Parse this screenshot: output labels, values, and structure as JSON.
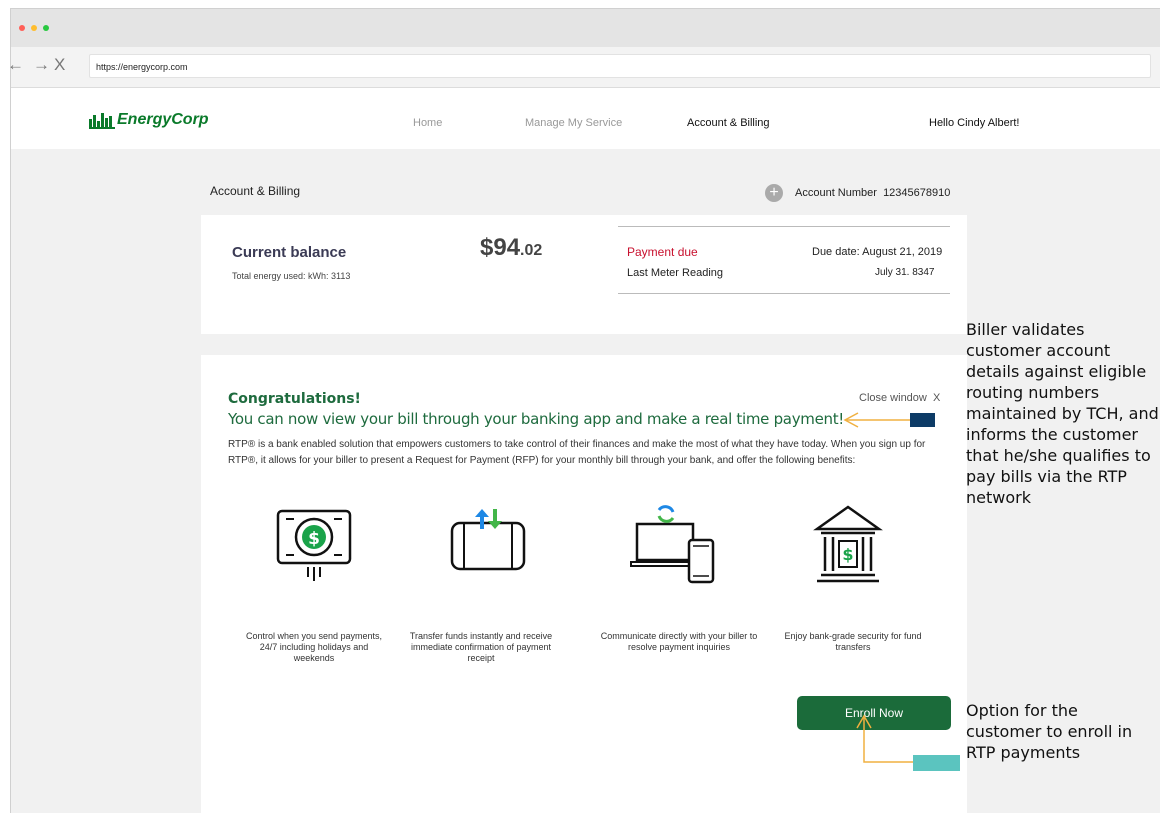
{
  "browser": {
    "url": "https://energycorp.com",
    "nav": {
      "back": "←",
      "forward": "→",
      "close": "X"
    }
  },
  "header": {
    "brand": "EnergyCorp",
    "nav": [
      {
        "label": "Home"
      },
      {
        "label": "Manage My Service"
      },
      {
        "label": "Account & Billing"
      }
    ],
    "greeting": "Hello Cindy Albert!"
  },
  "page": {
    "title": "Account & Billing",
    "account_label": "Account Number",
    "account_number": "12345678910",
    "plus_symbol": "+"
  },
  "balance": {
    "label": "Current balance",
    "energy_used": "Total energy used: kWh: 3113",
    "amount_dollars": "$94",
    "amount_cents": ".02",
    "payment_due_label": "Payment due",
    "due_date": "Due date: August 21, 2019",
    "meter_label": "Last Meter Reading",
    "meter_value": "July 31. 8347"
  },
  "promo": {
    "heading": "Congratulations!",
    "close_label": "Close window",
    "close_x": "X",
    "subheading": "You can now view your bill through your banking app and make a real time payment!",
    "description": "RTP® is a bank enabled solution that empowers customers to take control of their finances and make the most of what they have today. When you sign up for RTP®, it allows for your biller to present a Request for Payment (RFP) for your monthly bill through your bank, and offer the following benefits:",
    "benefits": [
      {
        "icon": "money-bill-icon",
        "text": "Control when you send payments, 24/7 including holidays and weekends"
      },
      {
        "icon": "transfer-icon",
        "text": "Transfer funds instantly and receive immediate confirmation of payment receipt"
      },
      {
        "icon": "devices-icon",
        "text": "Communicate directly with your biller to resolve payment inquiries"
      },
      {
        "icon": "bank-icon",
        "text": "Enjoy bank-grade security for fund transfers"
      }
    ],
    "enroll_label": "Enroll Now"
  },
  "annotations": {
    "validation_note": "Biller validates customer account details against eligible routing numbers maintained by TCH, and informs the customer that he/she qualifies to pay bills via the RTP network",
    "enroll_note": "Option for the customer to enroll in RTP payments"
  },
  "colors": {
    "brand_green": "#0a7a2a",
    "enroll_green": "#1b6b3a",
    "promo_green": "#1e6b3e",
    "payment_due_red": "#c8102e",
    "arrow_orange": "#f0b040",
    "marker_navy": "#0d3b66",
    "marker_teal": "#5bc4bf"
  }
}
